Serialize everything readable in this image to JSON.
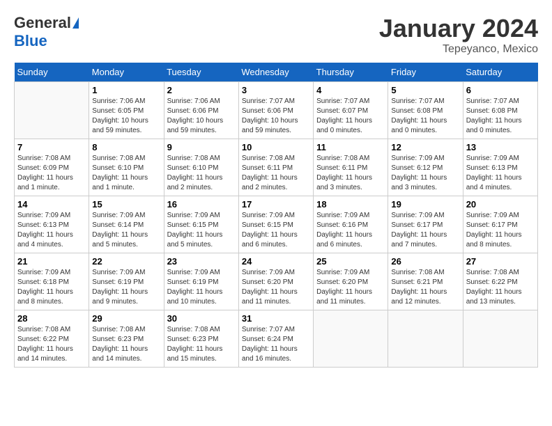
{
  "header": {
    "logo_general": "General",
    "logo_blue": "Blue",
    "month": "January 2024",
    "location": "Tepeyanco, Mexico"
  },
  "weekdays": [
    "Sunday",
    "Monday",
    "Tuesday",
    "Wednesday",
    "Thursday",
    "Friday",
    "Saturday"
  ],
  "weeks": [
    [
      {
        "day": null,
        "info": null
      },
      {
        "day": "1",
        "sunrise": "7:06 AM",
        "sunset": "6:05 PM",
        "daylight": "10 hours and 59 minutes."
      },
      {
        "day": "2",
        "sunrise": "7:06 AM",
        "sunset": "6:06 PM",
        "daylight": "10 hours and 59 minutes."
      },
      {
        "day": "3",
        "sunrise": "7:07 AM",
        "sunset": "6:06 PM",
        "daylight": "10 hours and 59 minutes."
      },
      {
        "day": "4",
        "sunrise": "7:07 AM",
        "sunset": "6:07 PM",
        "daylight": "11 hours and 0 minutes."
      },
      {
        "day": "5",
        "sunrise": "7:07 AM",
        "sunset": "6:08 PM",
        "daylight": "11 hours and 0 minutes."
      },
      {
        "day": "6",
        "sunrise": "7:07 AM",
        "sunset": "6:08 PM",
        "daylight": "11 hours and 0 minutes."
      }
    ],
    [
      {
        "day": "7",
        "sunrise": "7:08 AM",
        "sunset": "6:09 PM",
        "daylight": "11 hours and 1 minute."
      },
      {
        "day": "8",
        "sunrise": "7:08 AM",
        "sunset": "6:10 PM",
        "daylight": "11 hours and 1 minute."
      },
      {
        "day": "9",
        "sunrise": "7:08 AM",
        "sunset": "6:10 PM",
        "daylight": "11 hours and 2 minutes."
      },
      {
        "day": "10",
        "sunrise": "7:08 AM",
        "sunset": "6:11 PM",
        "daylight": "11 hours and 2 minutes."
      },
      {
        "day": "11",
        "sunrise": "7:08 AM",
        "sunset": "6:11 PM",
        "daylight": "11 hours and 3 minutes."
      },
      {
        "day": "12",
        "sunrise": "7:09 AM",
        "sunset": "6:12 PM",
        "daylight": "11 hours and 3 minutes."
      },
      {
        "day": "13",
        "sunrise": "7:09 AM",
        "sunset": "6:13 PM",
        "daylight": "11 hours and 4 minutes."
      }
    ],
    [
      {
        "day": "14",
        "sunrise": "7:09 AM",
        "sunset": "6:13 PM",
        "daylight": "11 hours and 4 minutes."
      },
      {
        "day": "15",
        "sunrise": "7:09 AM",
        "sunset": "6:14 PM",
        "daylight": "11 hours and 5 minutes."
      },
      {
        "day": "16",
        "sunrise": "7:09 AM",
        "sunset": "6:15 PM",
        "daylight": "11 hours and 5 minutes."
      },
      {
        "day": "17",
        "sunrise": "7:09 AM",
        "sunset": "6:15 PM",
        "daylight": "11 hours and 6 minutes."
      },
      {
        "day": "18",
        "sunrise": "7:09 AM",
        "sunset": "6:16 PM",
        "daylight": "11 hours and 6 minutes."
      },
      {
        "day": "19",
        "sunrise": "7:09 AM",
        "sunset": "6:17 PM",
        "daylight": "11 hours and 7 minutes."
      },
      {
        "day": "20",
        "sunrise": "7:09 AM",
        "sunset": "6:17 PM",
        "daylight": "11 hours and 8 minutes."
      }
    ],
    [
      {
        "day": "21",
        "sunrise": "7:09 AM",
        "sunset": "6:18 PM",
        "daylight": "11 hours and 8 minutes."
      },
      {
        "day": "22",
        "sunrise": "7:09 AM",
        "sunset": "6:19 PM",
        "daylight": "11 hours and 9 minutes."
      },
      {
        "day": "23",
        "sunrise": "7:09 AM",
        "sunset": "6:19 PM",
        "daylight": "11 hours and 10 minutes."
      },
      {
        "day": "24",
        "sunrise": "7:09 AM",
        "sunset": "6:20 PM",
        "daylight": "11 hours and 11 minutes."
      },
      {
        "day": "25",
        "sunrise": "7:09 AM",
        "sunset": "6:20 PM",
        "daylight": "11 hours and 11 minutes."
      },
      {
        "day": "26",
        "sunrise": "7:08 AM",
        "sunset": "6:21 PM",
        "daylight": "11 hours and 12 minutes."
      },
      {
        "day": "27",
        "sunrise": "7:08 AM",
        "sunset": "6:22 PM",
        "daylight": "11 hours and 13 minutes."
      }
    ],
    [
      {
        "day": "28",
        "sunrise": "7:08 AM",
        "sunset": "6:22 PM",
        "daylight": "11 hours and 14 minutes."
      },
      {
        "day": "29",
        "sunrise": "7:08 AM",
        "sunset": "6:23 PM",
        "daylight": "11 hours and 14 minutes."
      },
      {
        "day": "30",
        "sunrise": "7:08 AM",
        "sunset": "6:23 PM",
        "daylight": "11 hours and 15 minutes."
      },
      {
        "day": "31",
        "sunrise": "7:07 AM",
        "sunset": "6:24 PM",
        "daylight": "11 hours and 16 minutes."
      },
      {
        "day": null,
        "info": null
      },
      {
        "day": null,
        "info": null
      },
      {
        "day": null,
        "info": null
      }
    ]
  ]
}
